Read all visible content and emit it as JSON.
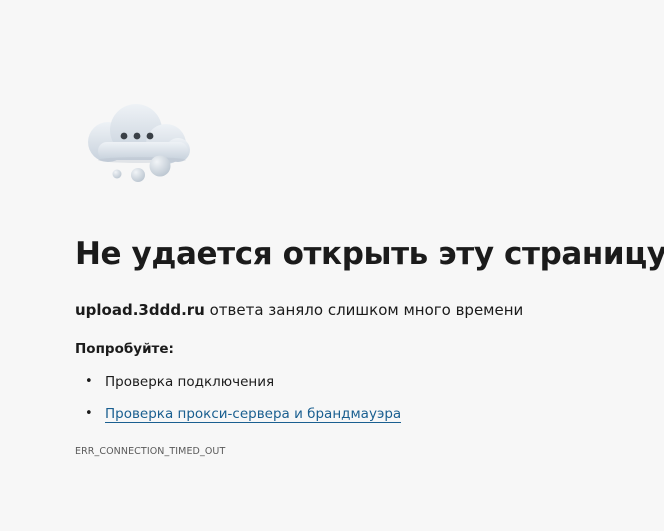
{
  "icon": "cloud-with-dots-icon",
  "title": "Не удается открыть эту страницу",
  "message": {
    "host": "upload.3ddd.ru",
    "text": " ответа заняло слишком много времени"
  },
  "try_label": "Попробуйте:",
  "suggestions": [
    {
      "label": "Проверка подключения",
      "is_link": false
    },
    {
      "label": "Проверка прокси-сервера и брандмауэра",
      "is_link": true
    }
  ],
  "error_code": "ERR_CONNECTION_TIMED_OUT",
  "colors": {
    "background": "#f7f7f7",
    "text": "#1b1b1b",
    "link": "#1a5f90",
    "cloud": "#d4dde6"
  }
}
